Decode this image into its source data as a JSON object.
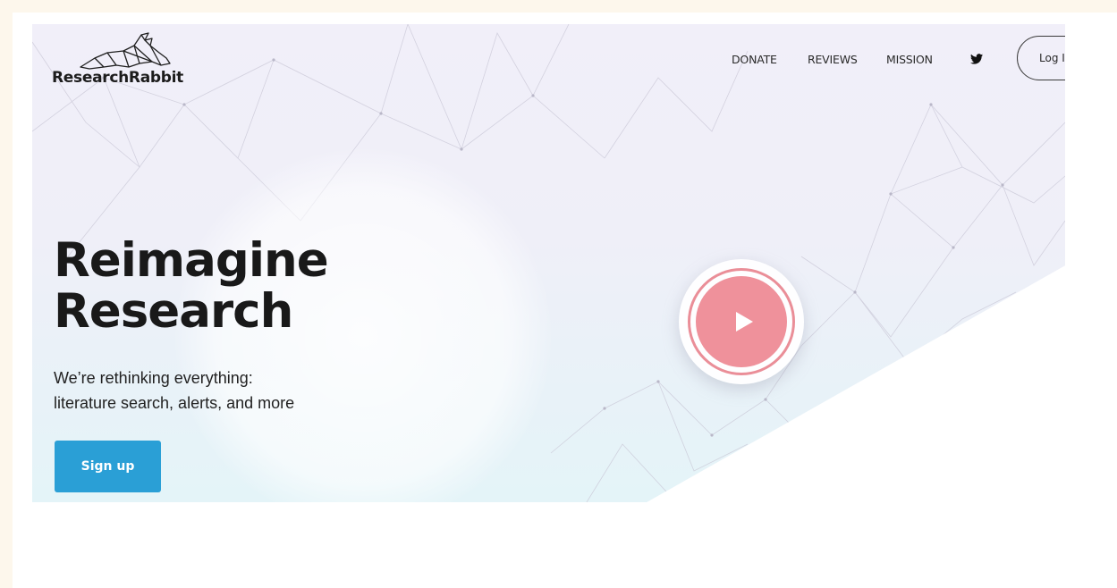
{
  "brand": {
    "name": "ResearchRabbit",
    "logo_icon": "rabbit-logo-icon"
  },
  "nav": {
    "items": [
      {
        "label": "DONATE"
      },
      {
        "label": "REVIEWS"
      },
      {
        "label": "MISSION"
      }
    ],
    "social_icon": "twitter-icon",
    "login_label": "Log I"
  },
  "hero": {
    "headline": [
      "Reimagine",
      "Research"
    ],
    "subtext": [
      "We’re rethinking everything:",
      "literature search, alerts, and more"
    ],
    "cta_label": "Sign up",
    "video_icon": "play-icon"
  },
  "colors": {
    "accent_blue": "#2a9fd6",
    "play_pink": "#ef919b",
    "page_border": "#fdf7ec"
  }
}
